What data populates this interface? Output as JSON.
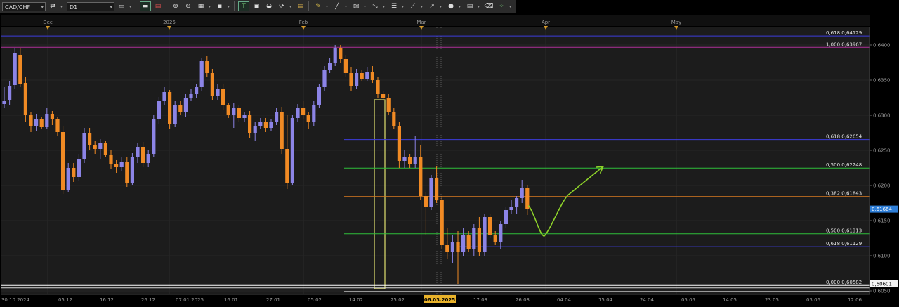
{
  "toolbar": {
    "symbol": "CAD/CHF",
    "timeframe": "D1",
    "icons": [
      "new-order-icon",
      "chart-type-icon",
      "bar-chart-icon",
      "candle-chart-icon",
      "zoom-in-icon",
      "zoom-out-icon",
      "grid-icon",
      "crosshair-icon",
      "text-icon",
      "template-icon",
      "indicators-icon",
      "refresh-icon",
      "color-icon",
      "pencil-icon",
      "line-tools-icon",
      "channel-icon",
      "gann-icon",
      "fibonacci-icon",
      "shapes-icon",
      "objects-icon",
      "erase-icon",
      "more-icon"
    ]
  },
  "chart_data": {
    "type": "candlestick",
    "symbol": "CAD/CHF",
    "timeframe": "D1",
    "y_axis": {
      "labels": [
        "0,6400",
        "0,6350",
        "0,6300",
        "0,6250",
        "0,6200",
        "0,6150",
        "0,6100",
        "0,6050"
      ],
      "values": [
        0.64,
        0.635,
        0.63,
        0.625,
        0.62,
        0.615,
        0.61,
        0.605
      ],
      "range": [
        0.6045,
        0.6425
      ]
    },
    "x_axis": {
      "date_labels": [
        "30.10.2024",
        "05.12",
        "16.12",
        "26.12",
        "07.01.2025",
        "16.01",
        "27.01",
        "05.02",
        "14.02",
        "25.02",
        "06.03.2025",
        "17.03",
        "26.03",
        "04.04",
        "15.04",
        "24.04",
        "05.05",
        "14.05",
        "23.05",
        "03.06",
        "12.06"
      ],
      "highlighted_label": "06.03.2025",
      "month_labels": [
        "Dec",
        "2025",
        "Feb",
        "Mar",
        "Apr",
        "May"
      ]
    },
    "current_price": {
      "label": "0,61664",
      "value": 0.61664
    },
    "support_price": {
      "label": "0,60601",
      "value": 0.60601
    },
    "levels": [
      {
        "text": "0,618 0,64129",
        "value": 0.64129,
        "color": "#3c3cdc"
      },
      {
        "text": "1,000 0,63967",
        "value": 0.63967,
        "color": "#b0309a"
      },
      {
        "text": "0,618 0,62654",
        "value": 0.62654,
        "color": "#3c3cdc"
      },
      {
        "text": "0,500 0,62248",
        "value": 0.62248,
        "color": "#2fbf3a"
      },
      {
        "text": "0,382 0,61843",
        "value": 0.61843,
        "color": "#d97a20"
      },
      {
        "text": "0,500 0,61313",
        "value": 0.61313,
        "color": "#2fbf3a"
      },
      {
        "text": "0,618 0,61129",
        "value": 0.61129,
        "color": "#3c3cdc"
      },
      {
        "text": "0,000 0,60582",
        "value": 0.60582,
        "color": "#ffffff"
      }
    ],
    "colors": {
      "up": "#8c84e6",
      "down": "#f08a24",
      "background": "#1c1c1c",
      "forecast": "#8ed32a"
    },
    "candles": [
      {
        "o": 0.6316,
        "h": 0.634,
        "l": 0.631,
        "c": 0.632
      },
      {
        "o": 0.6322,
        "h": 0.6348,
        "l": 0.6315,
        "c": 0.6342
      },
      {
        "o": 0.6343,
        "h": 0.6395,
        "l": 0.6338,
        "c": 0.6388
      },
      {
        "o": 0.6386,
        "h": 0.6395,
        "l": 0.634,
        "c": 0.6345
      },
      {
        "o": 0.6346,
        "h": 0.6355,
        "l": 0.629,
        "c": 0.63
      },
      {
        "o": 0.63,
        "h": 0.6305,
        "l": 0.6276,
        "c": 0.6285
      },
      {
        "o": 0.6285,
        "h": 0.6302,
        "l": 0.6278,
        "c": 0.6295
      },
      {
        "o": 0.6295,
        "h": 0.6298,
        "l": 0.628,
        "c": 0.6283
      },
      {
        "o": 0.6283,
        "h": 0.631,
        "l": 0.628,
        "c": 0.6302
      },
      {
        "o": 0.6302,
        "h": 0.6306,
        "l": 0.6286,
        "c": 0.6294
      },
      {
        "o": 0.6294,
        "h": 0.6298,
        "l": 0.627,
        "c": 0.6276
      },
      {
        "o": 0.6276,
        "h": 0.6284,
        "l": 0.6188,
        "c": 0.6194
      },
      {
        "o": 0.6194,
        "h": 0.6232,
        "l": 0.619,
        "c": 0.6225
      },
      {
        "o": 0.6225,
        "h": 0.6232,
        "l": 0.6205,
        "c": 0.6212
      },
      {
        "o": 0.6212,
        "h": 0.6245,
        "l": 0.6206,
        "c": 0.6238
      },
      {
        "o": 0.6238,
        "h": 0.6282,
        "l": 0.6232,
        "c": 0.6274
      },
      {
        "o": 0.6274,
        "h": 0.6282,
        "l": 0.625,
        "c": 0.6258
      },
      {
        "o": 0.6258,
        "h": 0.6264,
        "l": 0.6245,
        "c": 0.6252
      },
      {
        "o": 0.6252,
        "h": 0.6266,
        "l": 0.6238,
        "c": 0.626
      },
      {
        "o": 0.626,
        "h": 0.6264,
        "l": 0.624,
        "c": 0.6244
      },
      {
        "o": 0.6244,
        "h": 0.625,
        "l": 0.6224,
        "c": 0.623
      },
      {
        "o": 0.623,
        "h": 0.6236,
        "l": 0.6218,
        "c": 0.6226
      },
      {
        "o": 0.6226,
        "h": 0.624,
        "l": 0.622,
        "c": 0.6234
      },
      {
        "o": 0.6234,
        "h": 0.624,
        "l": 0.6198,
        "c": 0.6203
      },
      {
        "o": 0.6203,
        "h": 0.6246,
        "l": 0.62,
        "c": 0.624
      },
      {
        "o": 0.624,
        "h": 0.626,
        "l": 0.6232,
        "c": 0.6255
      },
      {
        "o": 0.6255,
        "h": 0.6262,
        "l": 0.6226,
        "c": 0.6232
      },
      {
        "o": 0.6232,
        "h": 0.625,
        "l": 0.6226,
        "c": 0.6245
      },
      {
        "o": 0.6245,
        "h": 0.63,
        "l": 0.624,
        "c": 0.6294
      },
      {
        "o": 0.6294,
        "h": 0.6326,
        "l": 0.6288,
        "c": 0.632
      },
      {
        "o": 0.632,
        "h": 0.634,
        "l": 0.6315,
        "c": 0.6333
      },
      {
        "o": 0.6333,
        "h": 0.6336,
        "l": 0.628,
        "c": 0.6288
      },
      {
        "o": 0.6288,
        "h": 0.632,
        "l": 0.6283,
        "c": 0.6315
      },
      {
        "o": 0.6315,
        "h": 0.632,
        "l": 0.63,
        "c": 0.6304
      },
      {
        "o": 0.6304,
        "h": 0.633,
        "l": 0.6298,
        "c": 0.6325
      },
      {
        "o": 0.6325,
        "h": 0.6338,
        "l": 0.632,
        "c": 0.633
      },
      {
        "o": 0.633,
        "h": 0.6345,
        "l": 0.6325,
        "c": 0.634
      },
      {
        "o": 0.634,
        "h": 0.6382,
        "l": 0.6335,
        "c": 0.6377
      },
      {
        "o": 0.6377,
        "h": 0.6384,
        "l": 0.6355,
        "c": 0.636
      },
      {
        "o": 0.636,
        "h": 0.6366,
        "l": 0.6322,
        "c": 0.6328
      },
      {
        "o": 0.6328,
        "h": 0.6345,
        "l": 0.6322,
        "c": 0.6338
      },
      {
        "o": 0.6338,
        "h": 0.6344,
        "l": 0.6308,
        "c": 0.6314
      },
      {
        "o": 0.6314,
        "h": 0.6318,
        "l": 0.6296,
        "c": 0.63
      },
      {
        "o": 0.63,
        "h": 0.6318,
        "l": 0.6282,
        "c": 0.631
      },
      {
        "o": 0.631,
        "h": 0.6314,
        "l": 0.629,
        "c": 0.6296
      },
      {
        "o": 0.6296,
        "h": 0.6304,
        "l": 0.629,
        "c": 0.63
      },
      {
        "o": 0.63,
        "h": 0.6306,
        "l": 0.6268,
        "c": 0.6274
      },
      {
        "o": 0.6274,
        "h": 0.629,
        "l": 0.6264,
        "c": 0.6284
      },
      {
        "o": 0.6284,
        "h": 0.6296,
        "l": 0.628,
        "c": 0.629
      },
      {
        "o": 0.629,
        "h": 0.6296,
        "l": 0.6276,
        "c": 0.6282
      },
      {
        "o": 0.6282,
        "h": 0.6294,
        "l": 0.6278,
        "c": 0.629
      },
      {
        "o": 0.629,
        "h": 0.631,
        "l": 0.6286,
        "c": 0.6305
      },
      {
        "o": 0.6305,
        "h": 0.6312,
        "l": 0.6245,
        "c": 0.6252
      },
      {
        "o": 0.6252,
        "h": 0.63,
        "l": 0.6195,
        "c": 0.6203
      },
      {
        "o": 0.6203,
        "h": 0.63,
        "l": 0.62,
        "c": 0.6296
      },
      {
        "o": 0.6296,
        "h": 0.6316,
        "l": 0.629,
        "c": 0.631
      },
      {
        "o": 0.631,
        "h": 0.632,
        "l": 0.6295,
        "c": 0.63
      },
      {
        "o": 0.63,
        "h": 0.6305,
        "l": 0.628,
        "c": 0.629
      },
      {
        "o": 0.629,
        "h": 0.632,
        "l": 0.6285,
        "c": 0.6315
      },
      {
        "o": 0.6315,
        "h": 0.6345,
        "l": 0.631,
        "c": 0.634
      },
      {
        "o": 0.634,
        "h": 0.637,
        "l": 0.6335,
        "c": 0.6365
      },
      {
        "o": 0.6365,
        "h": 0.6382,
        "l": 0.636,
        "c": 0.6375
      },
      {
        "o": 0.6375,
        "h": 0.64,
        "l": 0.637,
        "c": 0.6395
      },
      {
        "o": 0.6395,
        "h": 0.64,
        "l": 0.6375,
        "c": 0.638
      },
      {
        "o": 0.638,
        "h": 0.6386,
        "l": 0.6355,
        "c": 0.636
      },
      {
        "o": 0.636,
        "h": 0.6368,
        "l": 0.6335,
        "c": 0.6342
      },
      {
        "o": 0.6342,
        "h": 0.6366,
        "l": 0.6338,
        "c": 0.636
      },
      {
        "o": 0.636,
        "h": 0.6364,
        "l": 0.6348,
        "c": 0.6352
      },
      {
        "o": 0.6352,
        "h": 0.6368,
        "l": 0.6348,
        "c": 0.6362
      },
      {
        "o": 0.6362,
        "h": 0.637,
        "l": 0.6346,
        "c": 0.635
      },
      {
        "o": 0.635,
        "h": 0.6354,
        "l": 0.6325,
        "c": 0.633
      },
      {
        "o": 0.633,
        "h": 0.6335,
        "l": 0.632,
        "c": 0.6325
      },
      {
        "o": 0.6325,
        "h": 0.633,
        "l": 0.63,
        "c": 0.6305
      },
      {
        "o": 0.6305,
        "h": 0.631,
        "l": 0.628,
        "c": 0.6285
      },
      {
        "o": 0.6285,
        "h": 0.629,
        "l": 0.6225,
        "c": 0.6235
      },
      {
        "o": 0.6235,
        "h": 0.625,
        "l": 0.6225,
        "c": 0.624
      },
      {
        "o": 0.624,
        "h": 0.6245,
        "l": 0.6225,
        "c": 0.623
      },
      {
        "o": 0.623,
        "h": 0.627,
        "l": 0.6225,
        "c": 0.624
      },
      {
        "o": 0.624,
        "h": 0.6258,
        "l": 0.618,
        "c": 0.6185
      },
      {
        "o": 0.6185,
        "h": 0.619,
        "l": 0.613,
        "c": 0.617
      },
      {
        "o": 0.617,
        "h": 0.6215,
        "l": 0.6165,
        "c": 0.621
      },
      {
        "o": 0.621,
        "h": 0.6228,
        "l": 0.6175,
        "c": 0.618
      },
      {
        "o": 0.618,
        "h": 0.6185,
        "l": 0.611,
        "c": 0.6115
      },
      {
        "o": 0.6115,
        "h": 0.614,
        "l": 0.6095,
        "c": 0.6105
      },
      {
        "o": 0.6105,
        "h": 0.613,
        "l": 0.609,
        "c": 0.612
      },
      {
        "o": 0.612,
        "h": 0.6135,
        "l": 0.606,
        "c": 0.6105
      },
      {
        "o": 0.6105,
        "h": 0.614,
        "l": 0.61,
        "c": 0.613
      },
      {
        "o": 0.613,
        "h": 0.6135,
        "l": 0.6105,
        "c": 0.611
      },
      {
        "o": 0.611,
        "h": 0.6145,
        "l": 0.61,
        "c": 0.614
      },
      {
        "o": 0.614,
        "h": 0.6155,
        "l": 0.61,
        "c": 0.6105
      },
      {
        "o": 0.6105,
        "h": 0.616,
        "l": 0.61,
        "c": 0.6155
      },
      {
        "o": 0.6155,
        "h": 0.616,
        "l": 0.6125,
        "c": 0.613
      },
      {
        "o": 0.613,
        "h": 0.6135,
        "l": 0.6115,
        "c": 0.612
      },
      {
        "o": 0.612,
        "h": 0.615,
        "l": 0.611,
        "c": 0.6145
      },
      {
        "o": 0.6145,
        "h": 0.617,
        "l": 0.614,
        "c": 0.6165
      },
      {
        "o": 0.6165,
        "h": 0.618,
        "l": 0.616,
        "c": 0.617
      },
      {
        "o": 0.617,
        "h": 0.6185,
        "l": 0.616,
        "c": 0.6182
      },
      {
        "o": 0.6182,
        "h": 0.6208,
        "l": 0.6175,
        "c": 0.6196
      },
      {
        "o": 0.6196,
        "h": 0.62,
        "l": 0.6158,
        "c": 0.6166
      }
    ]
  }
}
